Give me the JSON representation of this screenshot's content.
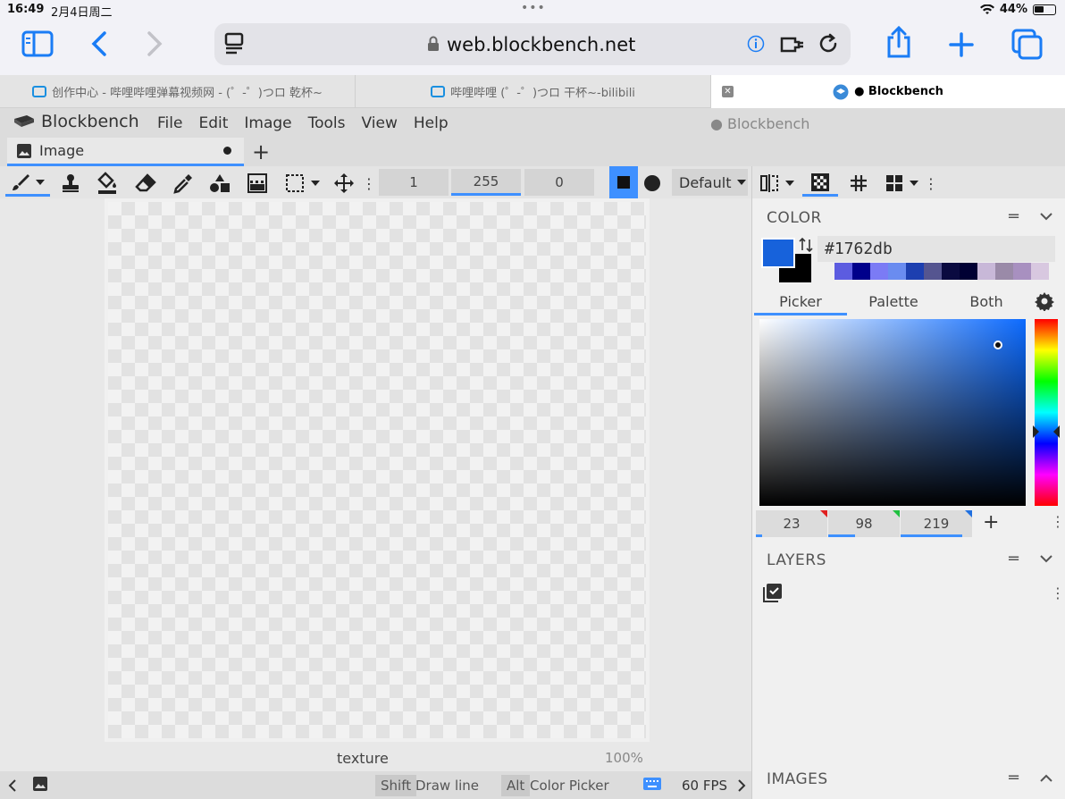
{
  "status": {
    "time": "16:49",
    "date": "2月4日周二",
    "battery": "44%"
  },
  "browser": {
    "url": "web.blockbench.net",
    "tabs": [
      {
        "label": "创作中心 - 哔哩哔哩弹幕视频网 - (゜-゜)つロ 乾杯~"
      },
      {
        "label": "哔哩哔哩 (゜-゜)つロ 干杯~-bilibili"
      },
      {
        "label": "● Blockbench"
      }
    ]
  },
  "app": {
    "logo": "Blockbench",
    "menu": [
      "File",
      "Edit",
      "Image",
      "Tools",
      "View",
      "Help"
    ],
    "title": "● Blockbench",
    "doc_tab": "Image"
  },
  "toolbar": {
    "brush_size": "1",
    "opacity": "255",
    "softness": "0",
    "blend_mode": "Default"
  },
  "canvas": {
    "texture_label": "texture",
    "zoom": "100%"
  },
  "bottom": {
    "shift_key": "Shift",
    "shift_action": "Draw line",
    "alt_key": "Alt",
    "alt_action": "Color Picker",
    "fps": "60 FPS"
  },
  "panels": {
    "color": {
      "title": "COLOR",
      "hex": "#1762db",
      "tabs": [
        "Picker",
        "Palette",
        "Both"
      ],
      "r": "23",
      "g": "98",
      "b": "219",
      "palette": [
        "#5c5ce0",
        "#00008b",
        "#7b7bf5",
        "#6a8cf0",
        "#1d3fb0",
        "#555590",
        "#0a0a40",
        "#000033",
        "#c8b8d8",
        "#9a8aa8",
        "#a890c0",
        "#d8c8e0"
      ]
    },
    "layers": {
      "title": "LAYERS"
    },
    "images": {
      "title": "IMAGES"
    }
  },
  "colors": {
    "accent": "#3e90ff",
    "primary_color": "#1762db",
    "secondary_color": "#000000"
  }
}
